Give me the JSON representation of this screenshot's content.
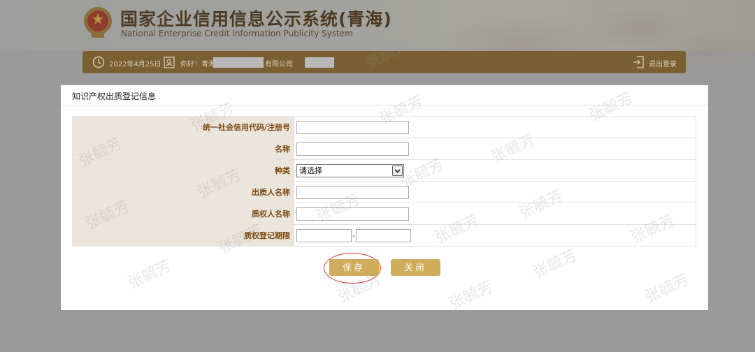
{
  "header": {
    "title_cn": "国家企业信用信息公示系统(青海)",
    "title_en": "National Enterprise Credit Information Publicity System"
  },
  "userbar": {
    "date": "2022年4月25日",
    "hello": "你好！青海",
    "suffix": "有限公司",
    "logout": "退出登录"
  },
  "modal": {
    "title": "知识产权出质登记信息",
    "fields": {
      "credit_code": {
        "label": "统一社会信用代码/注册号",
        "value": ""
      },
      "name": {
        "label": "名称",
        "value": ""
      },
      "type": {
        "label": "种类",
        "selected": "请选择"
      },
      "pledgor": {
        "label": "出质人名称",
        "value": ""
      },
      "pledgee": {
        "label": "质权人名称",
        "value": ""
      },
      "period": {
        "label": "质权登记期限",
        "separator": "-",
        "start": "",
        "end": ""
      }
    },
    "buttons": {
      "save": "保存",
      "close": "关闭"
    }
  },
  "watermark": {
    "text": "张毓芳"
  },
  "colors": {
    "accent": "#cfad5c",
    "userbar": "#7a5f32",
    "label_bg": "#ece5dc",
    "label_text": "#7a4a10",
    "highlight": "#dd3333"
  },
  "icons": [
    "emblem-icon",
    "clock-icon",
    "user-icon",
    "logout-icon",
    "dropdown-arrow-icon"
  ]
}
